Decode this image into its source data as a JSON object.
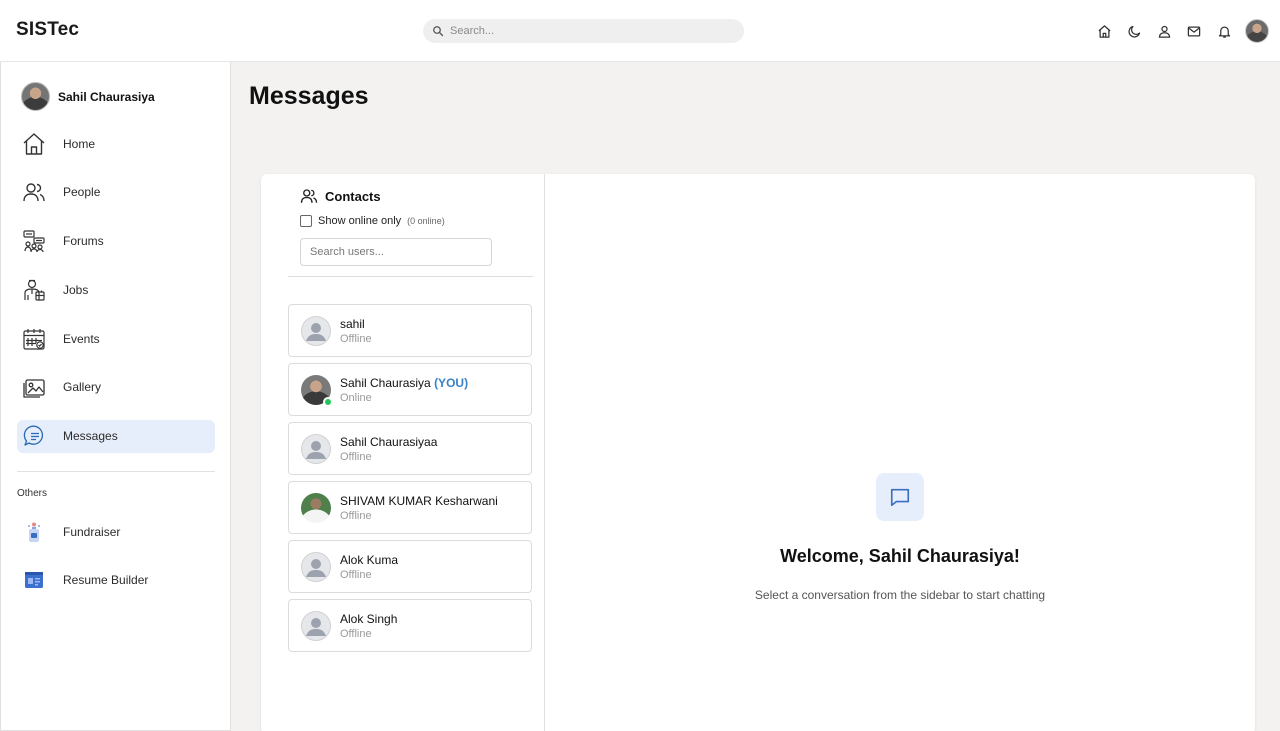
{
  "header": {
    "brand": "SISTec",
    "search_placeholder": "Search...",
    "icons": [
      "home-icon",
      "moon-icon",
      "user-icon",
      "mail-icon",
      "bell-icon"
    ]
  },
  "sidebar": {
    "profile_name": "Sahil Chaurasiya",
    "items": [
      {
        "label": "Home",
        "icon": "home-icon"
      },
      {
        "label": "People",
        "icon": "people-icon"
      },
      {
        "label": "Forums",
        "icon": "forums-icon"
      },
      {
        "label": "Jobs",
        "icon": "jobs-icon"
      },
      {
        "label": "Events",
        "icon": "calendar-icon"
      },
      {
        "label": "Gallery",
        "icon": "gallery-icon"
      },
      {
        "label": "Messages",
        "icon": "messages-icon",
        "active": true
      }
    ],
    "others_label": "Others",
    "others": [
      {
        "label": "Fundraiser",
        "icon": "fundraiser-icon"
      },
      {
        "label": "Resume Builder",
        "icon": "resume-icon"
      }
    ]
  },
  "main": {
    "title": "Messages",
    "contacts": {
      "title": "Contacts",
      "show_online_label": "Show online only",
      "online_count": "(0 online)",
      "search_placeholder": "Search users...",
      "list": [
        {
          "name": "sahil",
          "status": "Offline",
          "avatar": "default"
        },
        {
          "name": "Sahil Chaurasiya",
          "suffix": "(YOU)",
          "status": "Online",
          "avatar": "photo"
        },
        {
          "name": "Sahil Chaurasiyaa",
          "status": "Offline",
          "avatar": "default"
        },
        {
          "name": "SHIVAM KUMAR Kesharwani",
          "status": "Offline",
          "avatar": "photo2"
        },
        {
          "name": "Alok Kuma",
          "status": "Offline",
          "avatar": "default"
        },
        {
          "name": "Alok Singh",
          "status": "Offline",
          "avatar": "default"
        }
      ]
    },
    "welcome": {
      "title": "Welcome, Sahil Chaurasiya!",
      "subtitle": "Select a conversation from the sidebar to start chatting"
    }
  },
  "colors": {
    "accent": "#3b82c4",
    "active_nav_bg": "#e6eefb",
    "online": "#22c55e",
    "page_bg": "#f3f2f1"
  }
}
